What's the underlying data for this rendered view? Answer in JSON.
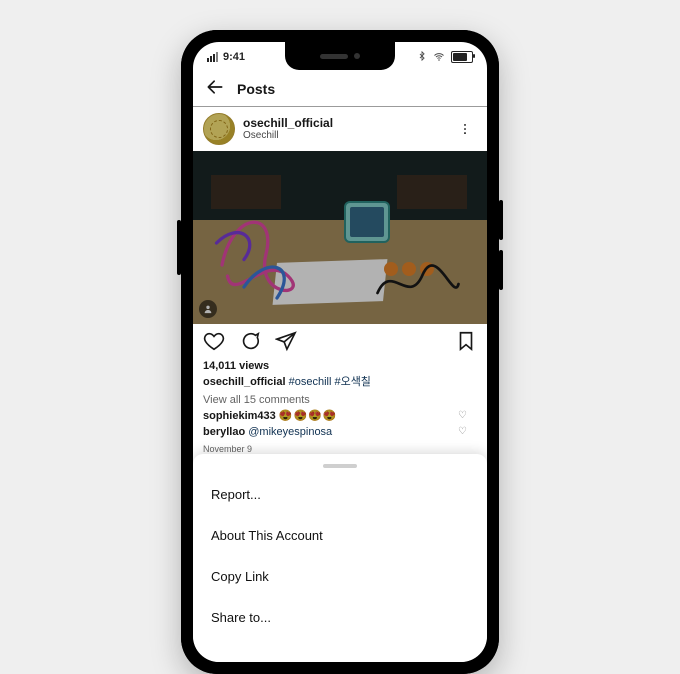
{
  "status": {
    "time": "9:41"
  },
  "nav": {
    "title": "Posts"
  },
  "post": {
    "username": "osechill_official",
    "subtitle": "Osechill",
    "views": "14,011 views",
    "caption_user": "osechill_official",
    "hashtags": "#osechill #오색칠",
    "view_comments": "View all 15 comments",
    "comment1_user": "sophiekim433",
    "comment1_text": "😍😍😍😍",
    "comment2_user": "beryllao",
    "comment2_mention": "@mikeyespinosa",
    "date": "November 9"
  },
  "peek": {
    "username": "osechill_official"
  },
  "sheet": {
    "items": [
      "Report...",
      "About This Account",
      "Copy Link",
      "Share to..."
    ]
  }
}
